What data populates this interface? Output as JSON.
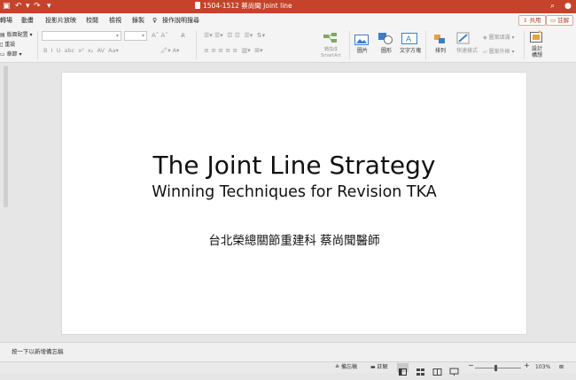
{
  "titlebar": {
    "doc_title": "1504-1512 蔡尚聞 Joint line",
    "undo_icon": "undo-icon",
    "redo_icon": "redo-icon"
  },
  "tabs": [
    {
      "label": "轉場",
      "active": false
    },
    {
      "label": "動畫",
      "active": false
    },
    {
      "label": "投影片放映",
      "active": false
    },
    {
      "label": "校閱",
      "active": false
    },
    {
      "label": "檢視",
      "active": false
    },
    {
      "label": "錄製",
      "active": false
    }
  ],
  "tell_me": "操作說明搜尋",
  "share_label": "共用",
  "comments_label": "註解",
  "ribbon": {
    "layout_label": "版面配置",
    "reset_label": "重設",
    "section_label": "章節",
    "convert_smartart": "轉換成",
    "smartart": "SmartArt",
    "picture": "圖片",
    "shapes": "圖形",
    "textbox": "文字方塊",
    "arrange": "排列",
    "quick_styles": "快速樣式",
    "shape_fill": "圖案填滿",
    "shape_outline": "圖案外框",
    "design_ideas_line1": "設計",
    "design_ideas_line2": "構想"
  },
  "slide": {
    "title": "The Joint Line Strategy",
    "subtitle": "Winning Techniques for Revision TKA",
    "author": "台北榮總關節重建科 蔡尚聞醫師"
  },
  "notes_placeholder": "按一下以新增備忘稿",
  "status": {
    "notes_label": "備忘稿",
    "comments_label": "註解",
    "zoom": "103%"
  },
  "colors": {
    "accent": "#c5422b",
    "ribbon_bg": "#f4f4f4",
    "workspace_bg": "#e6e6e6"
  }
}
